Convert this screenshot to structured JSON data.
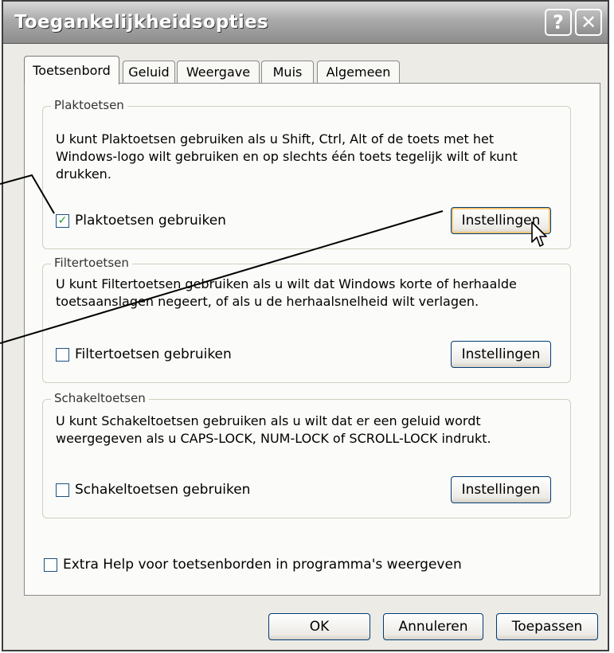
{
  "window": {
    "title": "Toegankelijkheidsopties",
    "help_button": "?",
    "close_button": "✕"
  },
  "tabs": [
    {
      "label": "Toetsenbord"
    },
    {
      "label": "Geluid"
    },
    {
      "label": "Weergave"
    },
    {
      "label": "Muis"
    },
    {
      "label": "Algemeen"
    }
  ],
  "groups": {
    "plak": {
      "title": "Plaktoetsen",
      "description_lines": [
        "U kunt Plaktoetsen gebruiken als u Shift, Ctrl, Alt of de toets met het",
        "Windows-logo wilt gebruiken en op slechts één toets tegelijk wilt of kunt",
        "drukken."
      ],
      "checkbox_label": "Plaktoetsen gebruiken",
      "checked": true,
      "button_label": "Instellingen"
    },
    "filter": {
      "title": "Filtertoetsen",
      "description_lines": [
        "U kunt Filtertoetsen gebruiken als u wilt dat Windows korte of herhaalde",
        "toetsaanslagen negeert, of als u de herhaalsnelheid wilt verlagen."
      ],
      "checkbox_label": "Filtertoetsen gebruiken",
      "checked": false,
      "button_label": "Instellingen"
    },
    "schakel": {
      "title": "Schakeltoetsen",
      "description_lines": [
        "U kunt Schakeltoetsen gebruiken als u wilt dat er een geluid wordt",
        "weergegeven als u CAPS-LOCK, NUM-LOCK of SCROLL-LOCK indrukt."
      ],
      "checkbox_label": "Schakeltoetsen gebruiken",
      "checked": false,
      "button_label": "Instellingen"
    }
  },
  "extra_help": {
    "label": "Extra Help voor toetsenborden in programma's weergeven",
    "checked": false
  },
  "footer": {
    "ok": "OK",
    "cancel": "Annuleren",
    "apply": "Toepassen"
  },
  "check_mark": "✓"
}
